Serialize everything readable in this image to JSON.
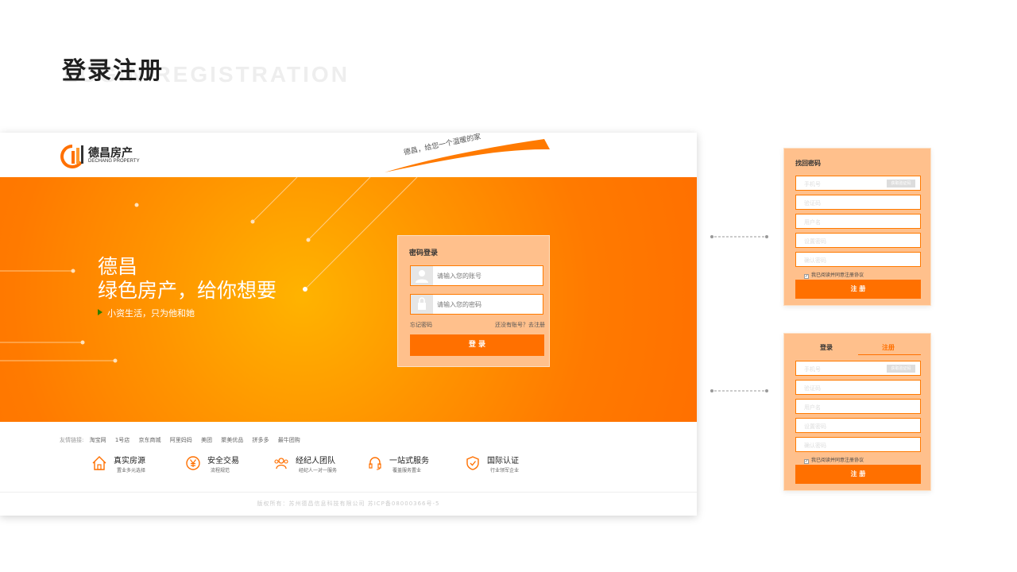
{
  "heading": {
    "cn": "登录注册",
    "en": "LOGIN REGISTRATION"
  },
  "site": {
    "logo_text": "德昌房产",
    "logo_sub": "DECHANG PROPERTY",
    "slogan": "德昌，给您一个温暖的家",
    "colors": {
      "accent": "#ff7000",
      "panel": "#ffc08c"
    }
  },
  "banner": {
    "title_line1": "德昌",
    "title_line2": "绿色房产，给你想要",
    "subtitle": "小资生活，只为他和她"
  },
  "login": {
    "title": "密码登录",
    "account_placeholder": "请输入您的账号",
    "password_placeholder": "请输入您的密码",
    "forgot": "忘记密码",
    "register_link": "还没有账号？去注册",
    "button": "登 录",
    "icons": [
      "user-icon",
      "lock-icon"
    ]
  },
  "friend_links": {
    "label": "友情链接:",
    "items": [
      "淘宝网",
      "1号店",
      "京东商城",
      "阿里妈妈",
      "美团",
      "聚美优品",
      "拼多多",
      "最牛团购"
    ]
  },
  "features": [
    {
      "title": "真实房源",
      "sub": "置业多元选择",
      "icon": "house-icon"
    },
    {
      "title": "安全交易",
      "sub": "流程规范",
      "icon": "yen-icon"
    },
    {
      "title": "经纪人团队",
      "sub": "经纪人一对一服务",
      "icon": "team-icon"
    },
    {
      "title": "一站式服务",
      "sub": "覆盖服务置业",
      "icon": "headset-icon"
    },
    {
      "title": "国际认证",
      "sub": "行业领军企业",
      "icon": "shield-icon"
    }
  ],
  "footer": "版权所有：苏州德昌信息科技有限公司 苏ICP备08000366号-5",
  "recover": {
    "title": "找回密码",
    "fields": [
      "手机号",
      "验证码",
      "用户名",
      "设置密码",
      "确认密码"
    ],
    "code_button": "获取验证码",
    "agree": "我已阅读并同意注册协议",
    "button": "注 册"
  },
  "register": {
    "tab_login": "登录",
    "tab_register": "注册",
    "fields": [
      "手机号",
      "验证码",
      "用户名",
      "设置密码",
      "确认密码"
    ],
    "code_button": "获取验证码",
    "agree": "我已阅读并同意注册协议",
    "button": "注 册"
  }
}
